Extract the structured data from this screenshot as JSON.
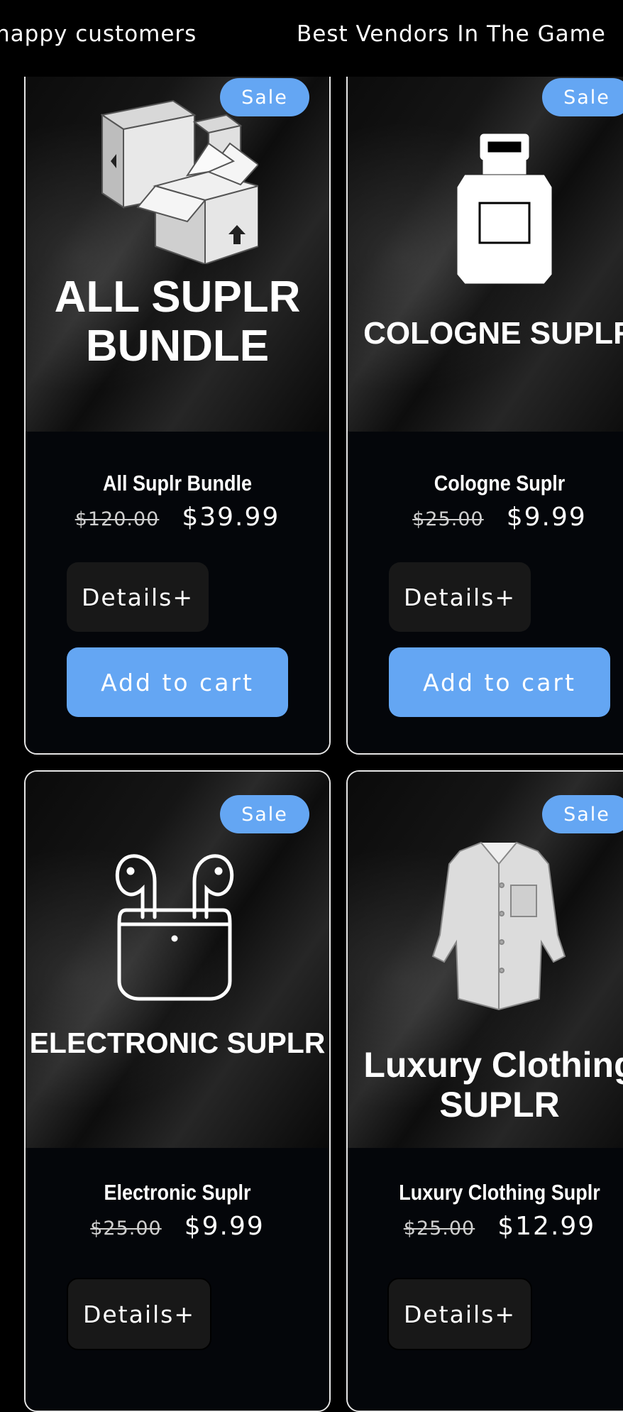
{
  "marquee": {
    "item_1": "happy customers",
    "item_2": "Best Vendors In The Game"
  },
  "products": [
    {
      "badge": "Sale",
      "banner": "ALL SUPLR\nBUNDLE",
      "icon": "boxes-icon",
      "title": "All Suplr Bundle",
      "compare_price": "$120.00",
      "price": "$39.99",
      "details_label": "Details+",
      "cart_label": "Add to cart"
    },
    {
      "badge": "Sale",
      "banner": "COLOGNE SUPLR",
      "icon": "cologne-bottle-icon",
      "title": "Cologne Suplr",
      "compare_price": "$25.00",
      "price": "$9.99",
      "details_label": "Details+",
      "cart_label": "Add to cart"
    },
    {
      "badge": "Sale",
      "banner": "ELECTRONIC SUPLR",
      "icon": "earbuds-icon",
      "title": "Electronic Suplr",
      "compare_price": "$25.00",
      "price": "$9.99",
      "details_label": "Details+"
    },
    {
      "badge": "Sale",
      "banner": "Luxury Clothing\nSUPLR",
      "icon": "shirt-icon",
      "title": "Luxury Clothing Suplr",
      "compare_price": "$25.00",
      "price": "$12.99",
      "details_label": "Details+"
    }
  ],
  "colors": {
    "accent": "#64a6f3",
    "background": "#000000",
    "button_dark": "#181818"
  }
}
